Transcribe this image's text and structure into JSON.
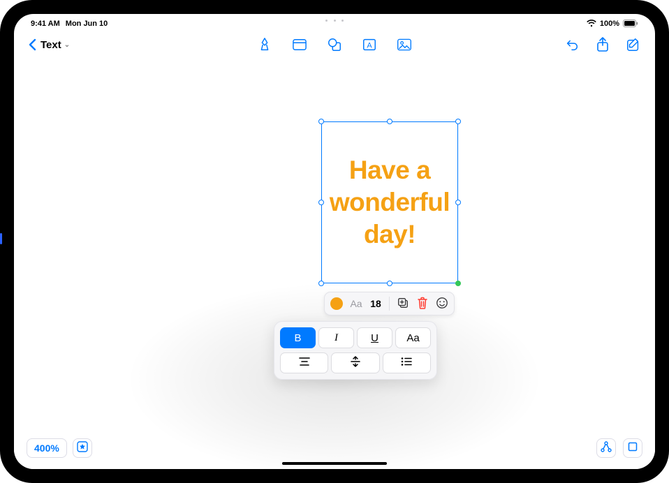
{
  "status": {
    "time": "9:41 AM",
    "date": "Mon Jun 10",
    "battery_pct": "100%"
  },
  "toolbar": {
    "back_title": "Text"
  },
  "textbox": {
    "content": "Have a wonderful day!",
    "color": "#f5a114"
  },
  "text_popover": {
    "font_sample": "Aa",
    "font_size": "18"
  },
  "format_panel": {
    "bold": "B",
    "italic": "I",
    "underline": "U",
    "caps": "Aa"
  },
  "bottom": {
    "zoom": "400%"
  }
}
